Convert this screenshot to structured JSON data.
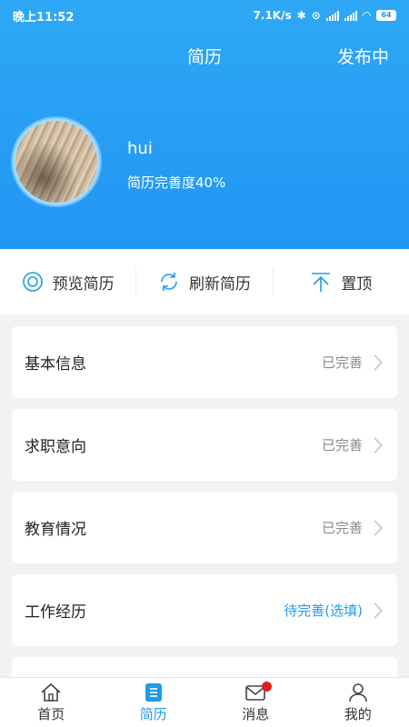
{
  "status_bar": {
    "time": "晚上11:52",
    "speed": "7.1K/s",
    "battery": "64"
  },
  "header": {
    "title": "简历",
    "publish_label": "发布中"
  },
  "profile": {
    "name": "hui",
    "completeness": "简历完善度40%"
  },
  "actions": [
    {
      "label": "预览简历",
      "icon": "eye-icon"
    },
    {
      "label": "刷新简历",
      "icon": "refresh-icon"
    },
    {
      "label": "置顶",
      "icon": "pin-top-icon"
    }
  ],
  "sections": [
    {
      "label": "基本信息",
      "status": "已完善"
    },
    {
      "label": "求职意向",
      "status": "已完善"
    },
    {
      "label": "教育情况",
      "status": "已完善"
    },
    {
      "label": "工作经历",
      "status": "待完善(选填)"
    }
  ],
  "tabs": [
    {
      "label": "首页",
      "icon": "home-icon"
    },
    {
      "label": "简历",
      "icon": "resume-icon"
    },
    {
      "label": "消息",
      "icon": "mail-icon"
    },
    {
      "label": "我的",
      "icon": "user-icon"
    }
  ],
  "colors": {
    "header": "#2196f3",
    "accent": "#1e9be9",
    "badge": "#e21f1f"
  }
}
